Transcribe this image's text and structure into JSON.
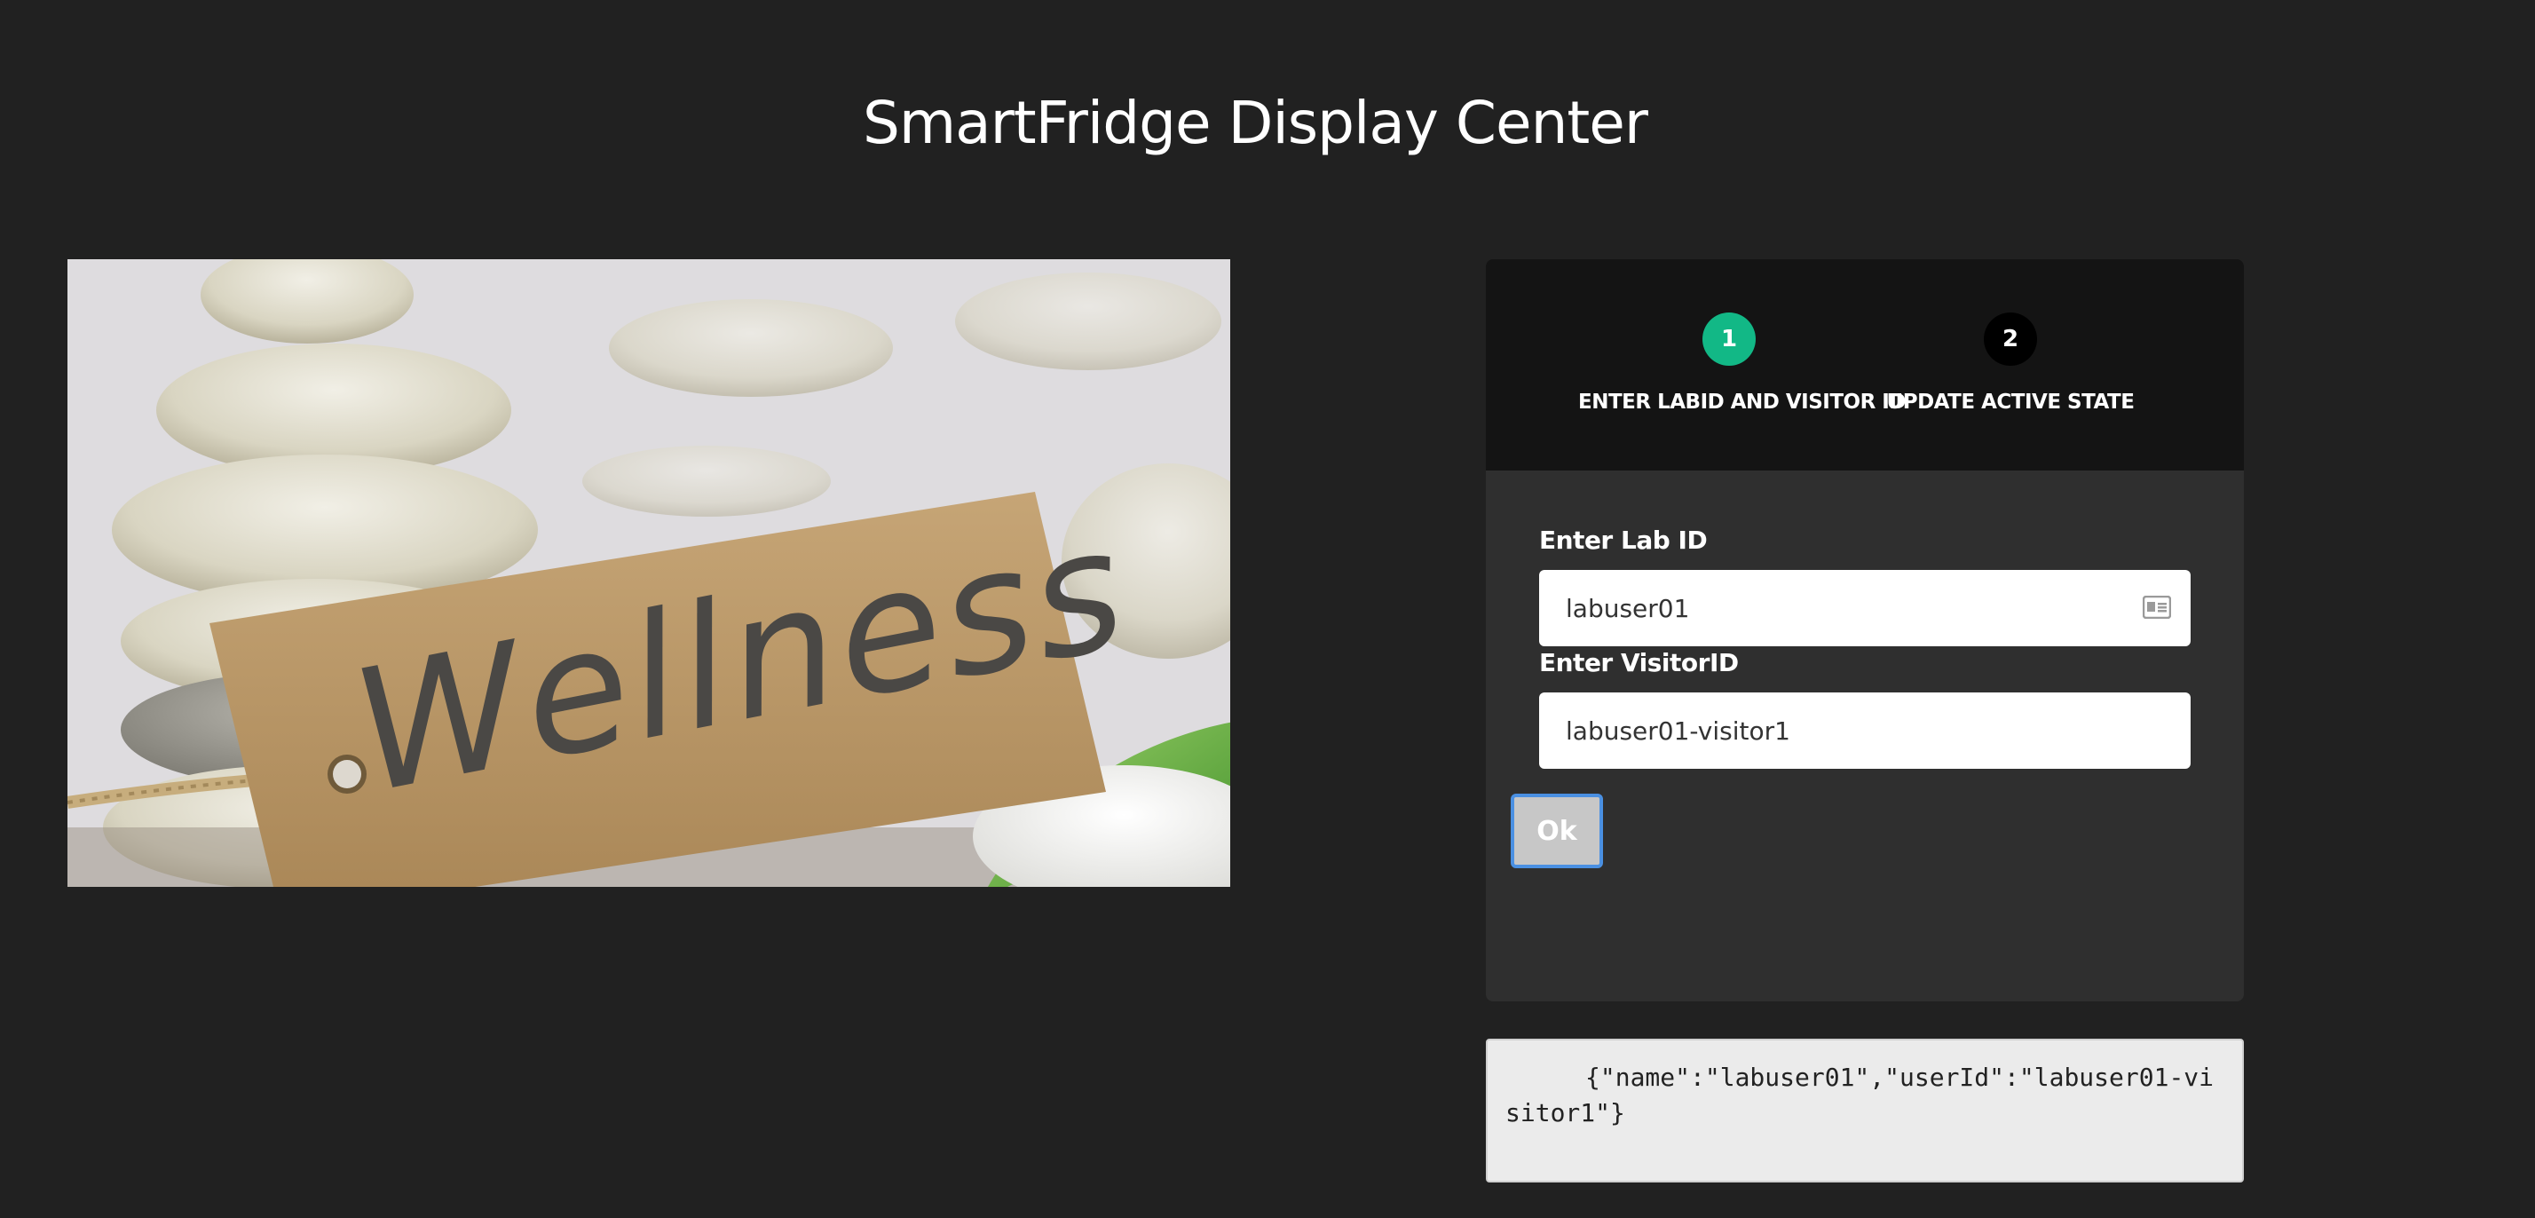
{
  "header": {
    "title": "SmartFridge Display Center"
  },
  "hero": {
    "tag_text": "Wellness"
  },
  "wizard": {
    "steps": [
      {
        "number": "1",
        "label": "ENTER LABID AND VISITOR ID",
        "status": "active",
        "color": "#12b886"
      },
      {
        "number": "2",
        "label": "UPDATE ACTIVE STATE",
        "status": "inactive",
        "color": "#000000"
      }
    ],
    "lab_id": {
      "label": "Enter Lab ID",
      "value": "labuser01",
      "icon": "id-card-icon"
    },
    "visitor_id": {
      "label": "Enter VisitorID",
      "value": "labuser01-visitor1"
    },
    "ok_label": "Ok"
  },
  "output": {
    "json_text": "{\"name\":\"labuser01\",\"userId\":\"labuser01-visitor1\"}"
  }
}
